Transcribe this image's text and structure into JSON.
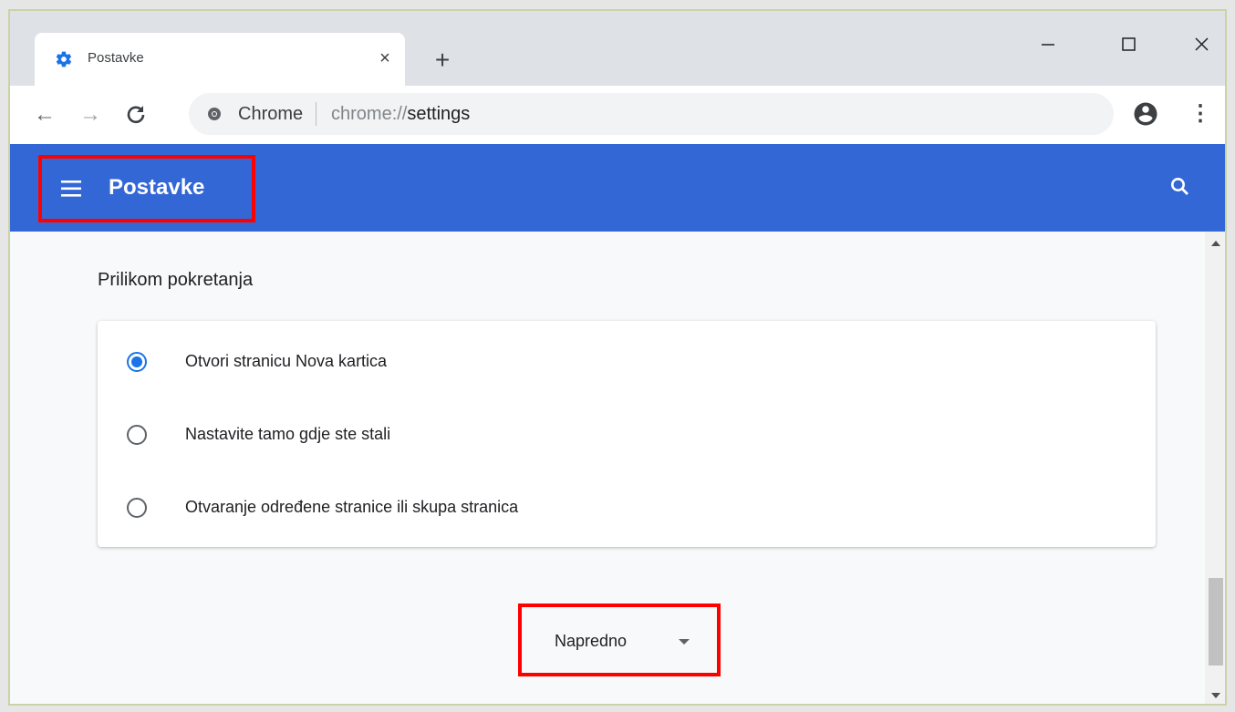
{
  "browser": {
    "tab": {
      "title": "Postavke",
      "icon": "gear-icon",
      "close_glyph": "×"
    },
    "new_tab_glyph": "+",
    "window_controls": {
      "minimize": "—",
      "maximize": "☐",
      "close": "✕"
    },
    "nav": {
      "back": "←",
      "forward": "→",
      "reload": "C"
    },
    "omnibox": {
      "site_label": "Chrome",
      "url_prefix": "chrome://",
      "url_path": "settings"
    },
    "bookmark_glyph": "☆",
    "menu_glyph": "⋮"
  },
  "settings": {
    "header_title": "Postavke",
    "section_title": "Prilikom pokretanja",
    "startup_options": [
      {
        "label": "Otvori stranicu Nova kartica",
        "checked": true
      },
      {
        "label": "Nastavite tamo gdje ste stali",
        "checked": false
      },
      {
        "label": "Otvaranje određene stranice ili skupa stranica",
        "checked": false
      }
    ],
    "advanced_label": "Napredno"
  },
  "colors": {
    "header_blue": "#3367d6",
    "radio_checked": "#1a73e8",
    "highlight_red": "#ff0000"
  }
}
